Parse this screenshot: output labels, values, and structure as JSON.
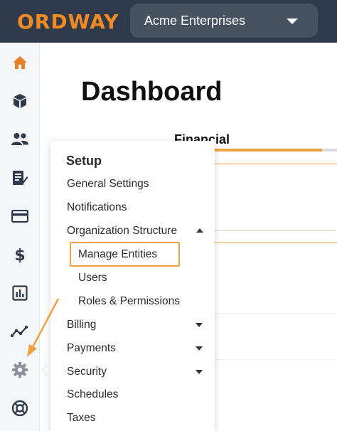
{
  "header": {
    "logo_text": "ORDWAY",
    "org_name": "Acme Enterprises"
  },
  "rail": {
    "items": [
      {
        "icon": "home-icon",
        "color": "#e8822a"
      },
      {
        "icon": "cube-icon"
      },
      {
        "icon": "users-icon"
      },
      {
        "icon": "document-edit-icon"
      },
      {
        "icon": "credit-card-icon"
      },
      {
        "icon": "dollar-icon"
      },
      {
        "icon": "bar-chart-icon"
      },
      {
        "icon": "trend-line-icon"
      },
      {
        "icon": "gear-icon"
      },
      {
        "icon": "lifebuoy-icon"
      }
    ]
  },
  "main": {
    "title": "Dashboard",
    "tab_label": "Financial",
    "card_value": ")"
  },
  "setup_menu": {
    "title": "Setup",
    "items": [
      {
        "label": "General Settings"
      },
      {
        "label": "Notifications"
      },
      {
        "label": "Organization Structure",
        "expanded": true
      },
      {
        "label": "Manage Entities",
        "sub": true,
        "highlighted": true
      },
      {
        "label": "Users",
        "sub": true
      },
      {
        "label": "Roles & Permissions",
        "sub": true
      },
      {
        "label": "Billing",
        "expanded": false
      },
      {
        "label": "Payments",
        "expanded": false
      },
      {
        "label": "Security",
        "expanded": false
      },
      {
        "label": "Schedules"
      },
      {
        "label": "Taxes"
      }
    ]
  },
  "colors": {
    "header_bg": "#2f3b4b",
    "brand_orange": "#f08a24",
    "highlight": "#f0a040",
    "icon_dark": "#2f3b4b"
  }
}
